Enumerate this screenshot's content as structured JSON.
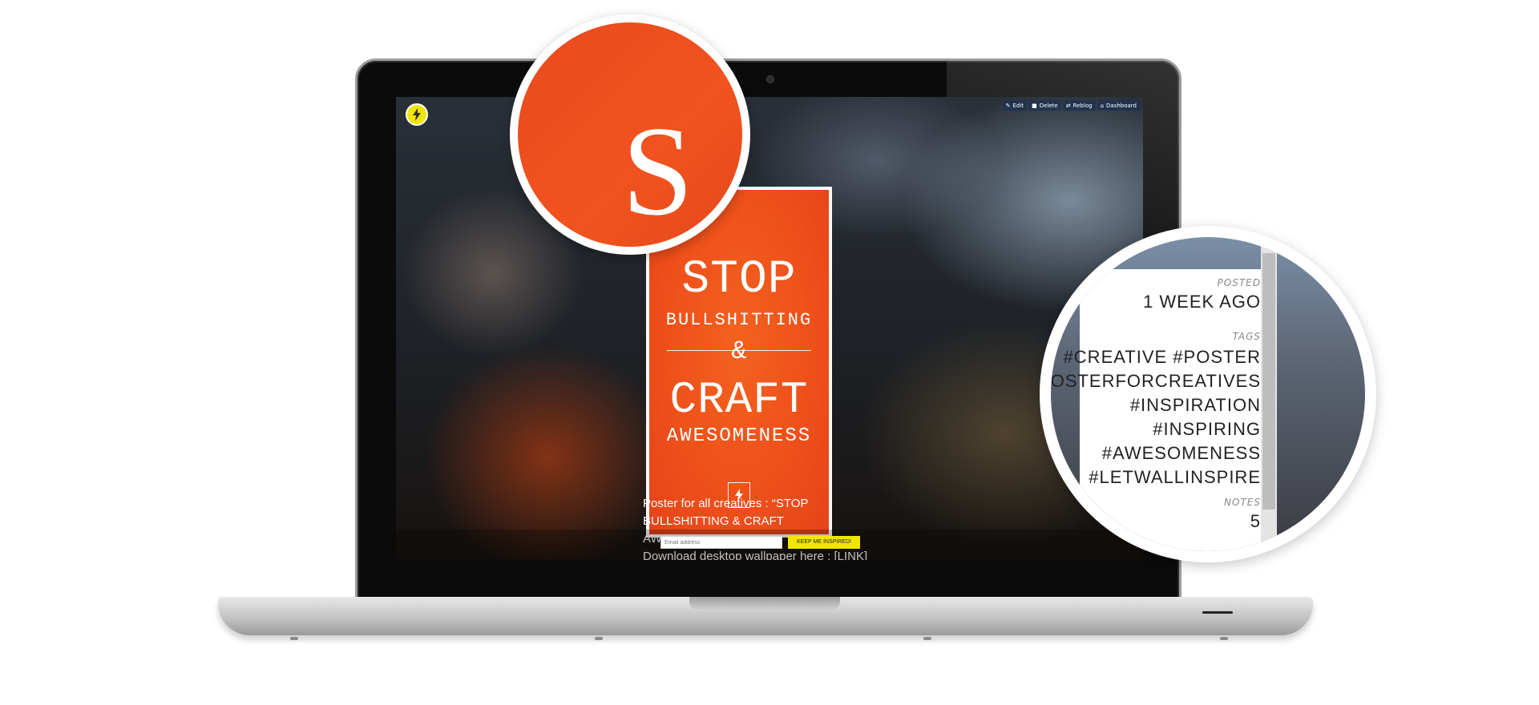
{
  "admin_bar": {
    "items": [
      {
        "label": "Edit",
        "icon": "edit-icon"
      },
      {
        "label": "Delete",
        "icon": "trash-icon"
      },
      {
        "label": "Reblog",
        "icon": "reblog-icon"
      },
      {
        "label": "Dashboard",
        "icon": "home-icon"
      }
    ]
  },
  "logo": {
    "icon": "lightning-icon",
    "accent": "#f2e600"
  },
  "poster": {
    "line1": "STOP",
    "line2": "BULLSHITTING",
    "amp": "&",
    "line3": "CRAFT",
    "line4": "AWESOMENESS",
    "color": "#ee4f1a"
  },
  "caption": {
    "line1": "Poster for all creatives : “STOP",
    "line2": "BULLSHITTING & CRAFT AWESOMENESS”",
    "line3": "Download desktop wallpaper here : [LINK]"
  },
  "subscribe": {
    "placeholder": "Email address",
    "button_label": "KEEP ME INSPIRED!"
  },
  "magnifier_logo": {
    "letter": "S"
  },
  "info": {
    "posted_label": "POSTED",
    "posted_value": "1 WEEK AGO",
    "tags_label": "TAGS",
    "tags": [
      "#CREATIVE #POSTER",
      "#POSTERFORCREATIVES",
      "#INSPIRATION",
      "#INSPIRING",
      "#AWESOMENESS",
      "#LETWALLINSPIRE"
    ],
    "notes_label": "NOTES",
    "notes_value": "5"
  }
}
